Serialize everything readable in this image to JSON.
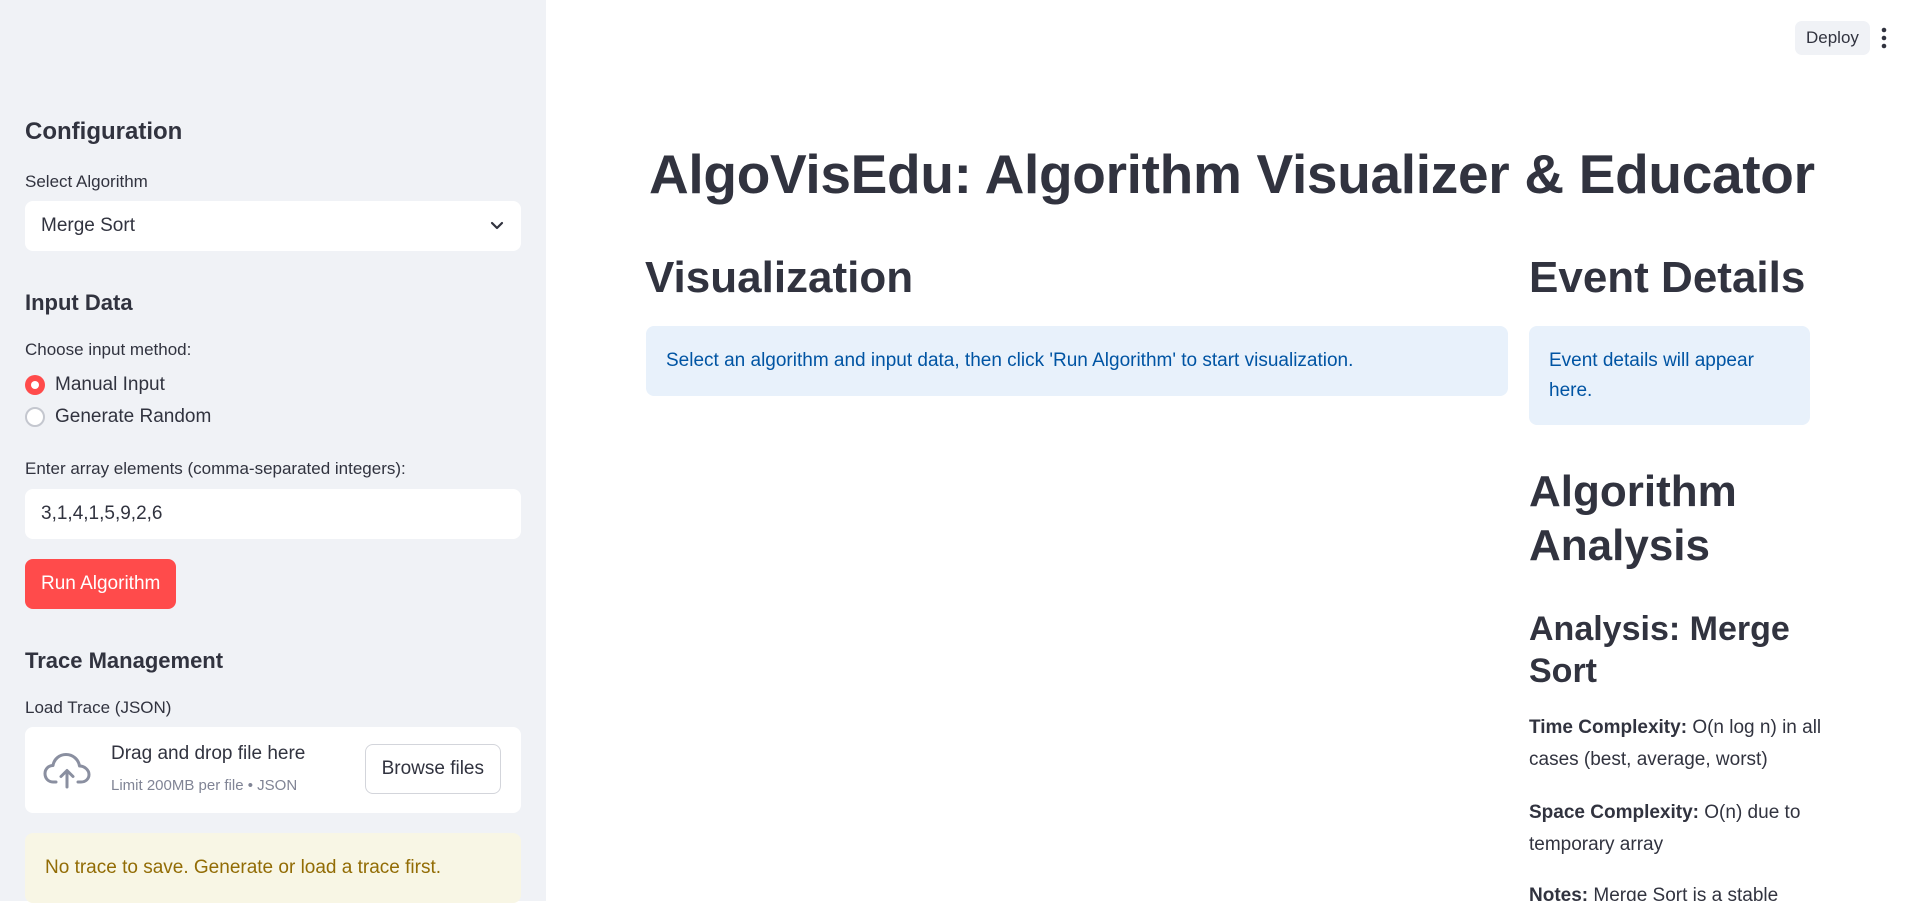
{
  "sidebar": {
    "configuration_heading": "Configuration",
    "select_algorithm_label": "Select Algorithm",
    "selected_algorithm": "Merge Sort",
    "input_data_heading": "Input Data",
    "input_method_label": "Choose input method:",
    "input_methods": [
      {
        "label": "Manual Input",
        "selected": true
      },
      {
        "label": "Generate Random",
        "selected": false
      }
    ],
    "array_label": "Enter array elements (comma-separated integers):",
    "array_value": "3,1,4,1,5,9,2,6",
    "run_button": "Run Algorithm",
    "trace_heading": "Trace Management",
    "load_trace_label": "Load Trace (JSON)",
    "uploader": {
      "drag_text": "Drag and drop file here",
      "limit_text": "Limit 200MB per file • JSON",
      "browse_button": "Browse files"
    },
    "warning": "No trace to save. Generate or load a trace first."
  },
  "header": {
    "deploy_button": "Deploy"
  },
  "main": {
    "title": "AlgoVisEdu: Algorithm Visualizer & Educator",
    "visualization_heading": "Visualization",
    "visualization_info": "Select an algorithm and input data, then click 'Run Algorithm' to start visualization.",
    "event_heading": "Event Details",
    "event_info": "Event details will appear here.",
    "analysis_heading": "Algorithm Analysis",
    "analysis_subheading": "Analysis: Merge Sort",
    "time_label": "Time Complexity:",
    "time_text": "O(n log n) in all cases (best, average, worst)",
    "space_label": "Space Complexity:",
    "space_text": "O(n) due to temporary array",
    "notes_label": "Notes:",
    "notes_text": "Merge Sort is a stable"
  },
  "colors": {
    "accent": "#ff4b4b",
    "sidebar_bg": "#f0f2f6",
    "info_bg": "#e8f1fb",
    "info_text": "#0054a3",
    "warning_bg": "#f8f6e5",
    "warning_text": "#926c05"
  },
  "icons": {
    "select_chevron": "chevron-down-icon",
    "uploader": "cloud-upload-icon",
    "menu": "kebab-menu-icon"
  }
}
